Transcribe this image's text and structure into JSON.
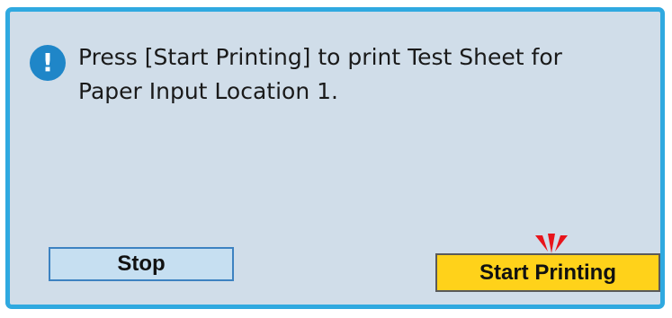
{
  "dialog": {
    "message_line1": "Press [Start Printing] to print Test Sheet for",
    "message_line2": "Paper Input Location 1.",
    "icon": "info-exclamation-icon"
  },
  "buttons": {
    "stop_label": "Stop",
    "start_label": "Start Printing"
  },
  "colors": {
    "panel_background": "#d0dde9",
    "panel_border": "#2fa9e0",
    "icon_background": "#1f86c8",
    "stop_background": "#c6dff1",
    "stop_border": "#3d82c1",
    "start_background": "#ffd21a",
    "attention_marker": "#e8141b"
  }
}
